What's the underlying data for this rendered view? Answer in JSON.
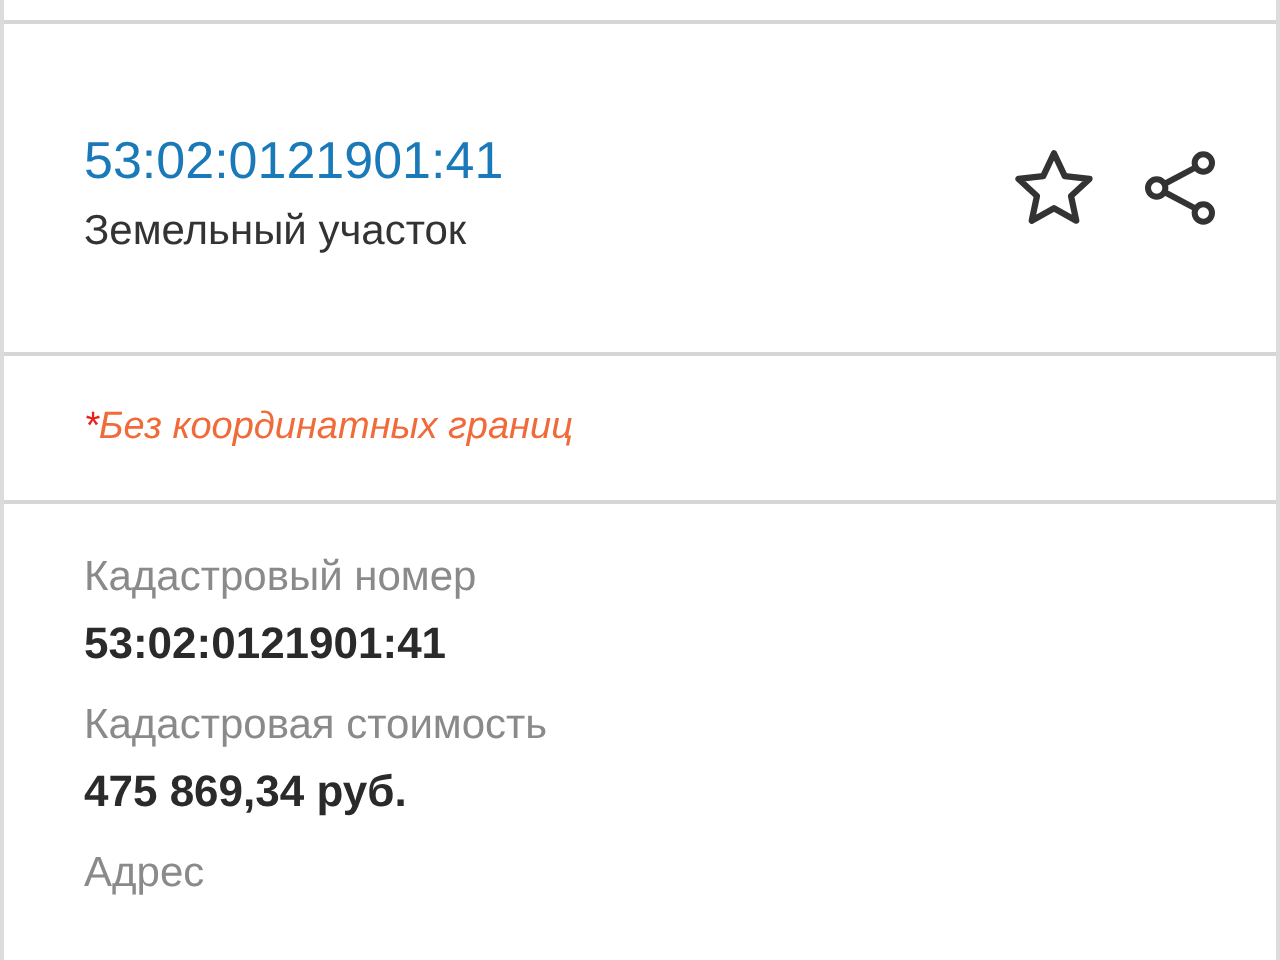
{
  "header": {
    "cadastral_number": "53:02:0121901:41",
    "type": "Земельный участок",
    "favorite": false
  },
  "notice": {
    "mark": "*",
    "text": "Без координатных границ"
  },
  "fields": [
    {
      "label": "Кадастровый номер",
      "value": "53:02:0121901:41"
    },
    {
      "label": "Кадастровая стоимость",
      "value": "475 869,34 руб."
    },
    {
      "label": "Адрес"
    }
  ]
}
